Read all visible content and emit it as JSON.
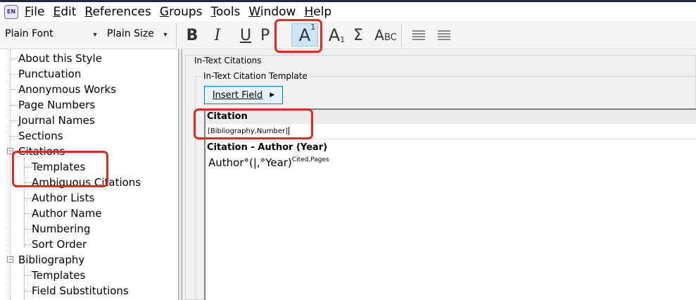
{
  "app": {
    "icon_text": "EN"
  },
  "menu": [
    {
      "pre": "",
      "key": "F",
      "post": "ile"
    },
    {
      "pre": "",
      "key": "E",
      "post": "dit"
    },
    {
      "pre": "",
      "key": "R",
      "post": "eferences"
    },
    {
      "pre": "",
      "key": "G",
      "post": "roups"
    },
    {
      "pre": "",
      "key": "T",
      "post": "ools"
    },
    {
      "pre": "",
      "key": "W",
      "post": "indow"
    },
    {
      "pre": "",
      "key": "H",
      "post": "elp"
    }
  ],
  "toolbar": {
    "font_value": "Plain Font",
    "size_value": "Plain Size",
    "bold": "B",
    "italic": "I",
    "underline": "U",
    "plain": "P",
    "superscript_base": "A",
    "superscript_mark": "1",
    "subscript_base": "A",
    "subscript_mark": "1",
    "symbol": "Σ",
    "smallcaps_big": "A",
    "smallcaps_small": "BC"
  },
  "tree": {
    "items": [
      "About this Style",
      "Punctuation",
      "Anonymous Works",
      "Page Numbers",
      "Journal Names",
      "Sections",
      "Citations",
      "Templates",
      "Ambiguous Citations",
      "Author Lists",
      "Author Name",
      "Numbering",
      "Sort Order",
      "Bibliography",
      "Templates",
      "Field Substitutions"
    ]
  },
  "panel": {
    "outer_title": "In-Text Citations",
    "inner_title": "In-Text Citation Template",
    "insert_label": "Insert Field",
    "citation_label": "Citation",
    "citation_value": "[Bibliography,Number]",
    "citation2_label": "Citation - Author (Year)",
    "citation2_main": "Author°(|,°Year)",
    "citation2_sup": "Cited,Pages"
  }
}
